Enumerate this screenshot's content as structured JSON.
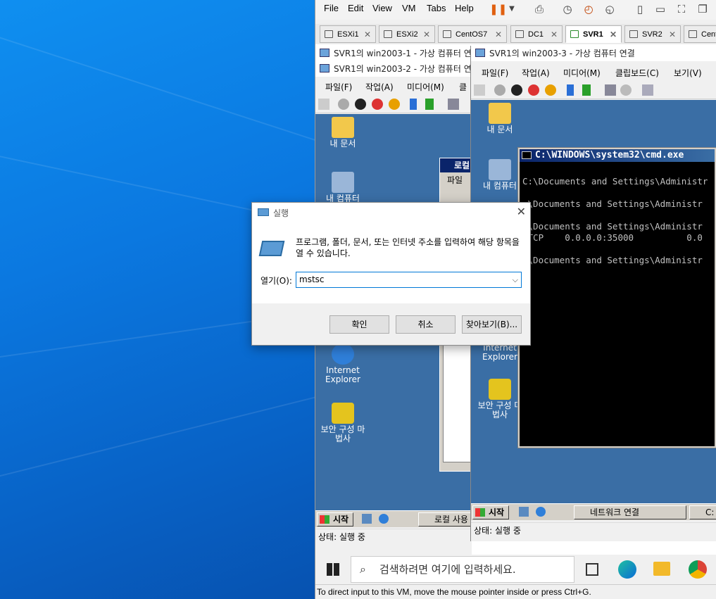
{
  "vmware": {
    "menu": [
      "File",
      "Edit",
      "View",
      "VM",
      "Tabs",
      "Help"
    ],
    "tabs": [
      "ESXi1",
      "ESXi2",
      "CentOS7",
      "DC1",
      "SVR1",
      "SVR2",
      "Cent"
    ],
    "active_tab": "SVR1",
    "bottom_status": "To direct input to this VM, move the mouse pointer inside or press Ctrl+G."
  },
  "hv1": {
    "title": "SVR1의 win2003-1 - 가상 컴퓨터 연"
  },
  "hv2": {
    "title": "SVR1의 win2003-2 - 가상 컴퓨터 연",
    "menu": [
      "파일(F)",
      "작업(A)",
      "미디어(M)",
      "클립"
    ],
    "icons": {
      "my_docs": "내 문서",
      "my_computer": "내 컴퓨터",
      "ie": "Internet Explorer",
      "security": "보안 구성 마법사"
    },
    "inner_window": {
      "title": "로컬",
      "menu": "파일"
    },
    "start": "시작",
    "task": "로컬 사용",
    "status": "상태: 실행 중"
  },
  "hv3": {
    "title": "SVR1의 win2003-3 - 가상 컴퓨터 연결",
    "menu": [
      "파일(F)",
      "작업(A)",
      "미디어(M)",
      "클립보드(C)",
      "보기(V)"
    ],
    "icons": {
      "my_docs": "내 문서",
      "my_computer": "내 컴퓨터",
      "ie": "Internet Explorer",
      "security": "보안 구성 마법사"
    },
    "start": "시작",
    "task1": "네트워크 연결",
    "task2": "C:",
    "status": "상태: 실행 중"
  },
  "cmd": {
    "title": "C:\\WINDOWS\\system32\\cmd.exe",
    "lines": [
      "C:\\Documents and Settings\\Administr",
      ":\\Documents and Settings\\Administr",
      " \\Documents and Settings\\Administr",
      " TCP    0.0.0.0:35000          0.0",
      " \\Documents and Settings\\Administr"
    ]
  },
  "run": {
    "title": "실행",
    "description": "프로그램, 폴더, 문서, 또는 인터넷 주소를 입력하여 해당 항목을 열 수 있습니다.",
    "open_label": "열기(O):",
    "value": "mstsc",
    "ok": "확인",
    "cancel": "취소",
    "browse": "찾아보기(B)..."
  },
  "win10": {
    "search_placeholder": "검색하려면 여기에 입력하세요."
  }
}
